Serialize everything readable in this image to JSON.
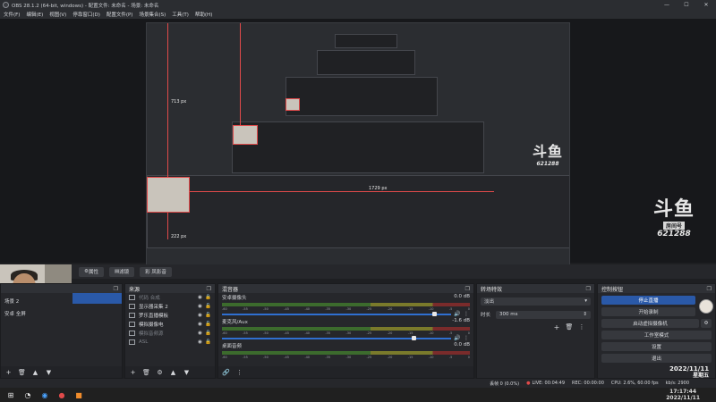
{
  "window": {
    "title": "OBS 28.1.2 (64-bit, windows) - 配置文件: 未命名 - 场景: 未命名",
    "minimize": "—",
    "maximize": "☐",
    "close": "✕"
  },
  "menu": [
    "文件(F)",
    "编辑(E)",
    "视图(V)",
    "停靠窗口(D)",
    "配置文件(P)",
    "场景集合(S)",
    "工具(T)",
    "帮助(H)"
  ],
  "preview": {
    "dim_vertical_1": "713 px",
    "dim_vertical_2": "222 px",
    "dim_horizontal": "1729 px",
    "logo_big": "斗鱼",
    "logo_room": "房间号",
    "logo_number": "621288"
  },
  "toolbar": {
    "properties": "属性",
    "filters": "滤镜",
    "studio_mode_label": "彩 凤影音"
  },
  "scenes": {
    "items": [
      "场景 2",
      "安卓 全屏"
    ]
  },
  "sources": {
    "title": "来源",
    "items": [
      {
        "label": "代码 合成",
        "active": false
      },
      {
        "label": "显示器采集 2",
        "active": true
      },
      {
        "label": "罗乐直播模板",
        "active": true
      },
      {
        "label": "模拟摄像电",
        "active": true
      },
      {
        "label": "模拟音频源",
        "active": false
      },
      {
        "label": "ASL",
        "active": false
      }
    ]
  },
  "mixer": {
    "title": "混音器",
    "tracks": [
      {
        "name": "安卓摄像头",
        "db": "0.0 dB",
        "level": 0.93
      },
      {
        "name": "麦克风/Aux",
        "db": "-1.6 dB",
        "level": 0.84
      },
      {
        "name": "桌面音频",
        "db": "0.0 dB",
        "level": 1.0
      }
    ],
    "scale": [
      "-60",
      "-55",
      "-50",
      "-45",
      "-40",
      "-35",
      "-30",
      "-25",
      "-20",
      "-15",
      "-10",
      "-5",
      "0"
    ]
  },
  "transitions": {
    "title": "转场特效",
    "type": "淡出",
    "duration_label": "时长",
    "duration": "300 ms"
  },
  "controls": {
    "title": "控制按钮",
    "stop_streaming": "停止直播",
    "start_recording": "开始录制",
    "virtual_camera": "启动虚拟摄像机",
    "studio_mode": "工作室模式",
    "settings": "设置",
    "exit": "退出"
  },
  "status": {
    "dropped": "丢帧 0 (0.0%)",
    "live": "LIVE: 00:04:49",
    "rec": "REC: 00:00:00",
    "cpu": "CPU: 2.6%, 60.00 fps",
    "bitrate": "kb/s: 2900"
  },
  "clock": {
    "date": "2022/11/11",
    "weekday": "星期五",
    "time": "17:17:44"
  }
}
